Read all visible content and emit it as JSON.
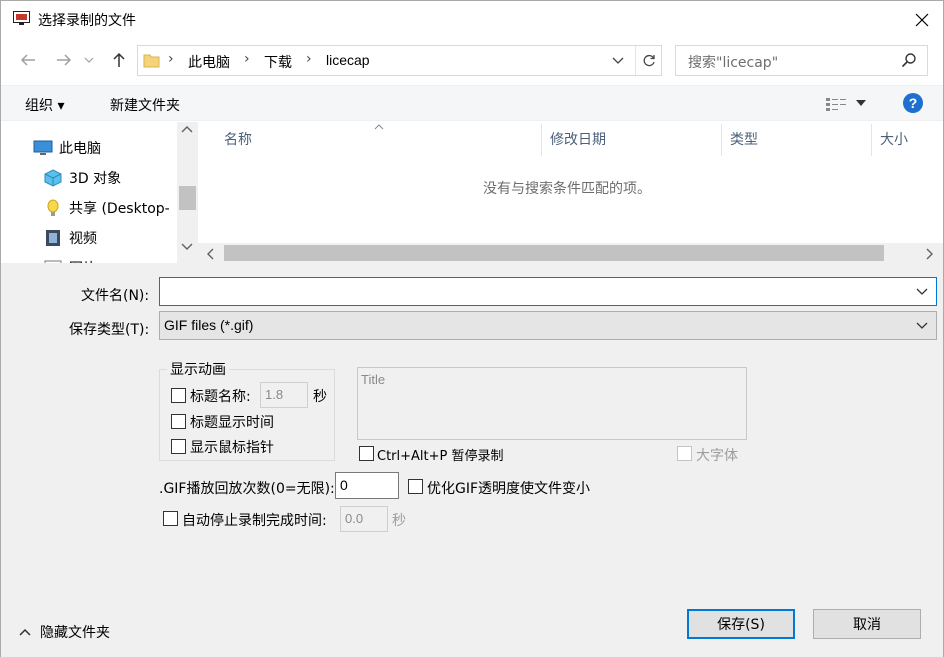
{
  "window": {
    "title": "选择录制的文件"
  },
  "address": {
    "segments": [
      "此电脑",
      "下载",
      "licecap"
    ],
    "search_placeholder": "搜索\"licecap\""
  },
  "toolbar": {
    "organize_label": "组织 ▾",
    "new_folder_label": "新建文件夹",
    "help_label": "?"
  },
  "nav_pane": {
    "items": [
      {
        "label": "此电脑",
        "icon": "computer-icon"
      },
      {
        "label": "3D 对象",
        "icon": "3d-objects-icon"
      },
      {
        "label": "共享 (Desktop-",
        "icon": "shared-folder-icon"
      },
      {
        "label": "视频",
        "icon": "video-icon"
      },
      {
        "label": "图片",
        "icon": "pictures-icon"
      }
    ]
  },
  "list_pane": {
    "columns": [
      "名称",
      "修改日期",
      "类型",
      "大小"
    ],
    "empty_message": "没有与搜索条件匹配的项。"
  },
  "form": {
    "filename_label": "文件名(N):",
    "filename_value": "",
    "filetype_label": "保存类型(T):",
    "filetype_value": "GIF files (*.gif)"
  },
  "options": {
    "group_title": "显示动画",
    "title_name_label": "标题名称:",
    "title_name_seconds": "1.8",
    "seconds_unit": "秒",
    "show_title_time_label": "标题显示时间",
    "show_cursor_label": "显示鼠标指针",
    "title_placeholder": "Title",
    "pause_label": "Ctrl+Alt+P 暂停录制",
    "large_font_label": "大字体",
    "loop_label": ".GIF播放回放次数(0=无限):",
    "loop_value": "0",
    "optimize_label": "优化GIF透明度使文件变小",
    "auto_stop_label": "自动停止录制完成时间:",
    "auto_stop_value": "0.0",
    "auto_stop_unit": "秒"
  },
  "footer": {
    "hide_folders_label": "隐藏文件夹",
    "save_label": "保存(S)",
    "cancel_label": "取消"
  },
  "colors": {
    "accent": "#0078d7",
    "help": "#1e6fd0",
    "panel": "#f0f0f0"
  }
}
